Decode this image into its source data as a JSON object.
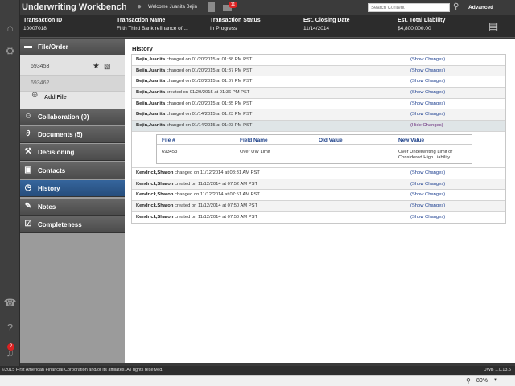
{
  "header": {
    "app_title": "Underwriting Workbench",
    "welcome": "Welcome Juanita Bejin",
    "mail_badge": "11",
    "search_placeholder": "Search Content",
    "advanced_label": "Advanced"
  },
  "transaction": {
    "id_label": "Transaction ID",
    "id_value": "10007018",
    "name_label": "Transaction Name",
    "name_value": "Fifth Third Bank refinance of ...",
    "status_label": "Transaction Status",
    "status_value": "In Progress",
    "closing_label": "Est. Closing Date",
    "closing_value": "11/14/2014",
    "liability_label": "Est. Total Liability",
    "liability_value": "$4,800,000.00"
  },
  "sidebar": {
    "file_order": "File/Order",
    "files": [
      "693453",
      "693462"
    ],
    "add_file": "Add File",
    "items": [
      {
        "label": "Collaboration (0)"
      },
      {
        "label": "Documents (5)"
      },
      {
        "label": "Decisioning"
      },
      {
        "label": "Contacts"
      },
      {
        "label": "History"
      },
      {
        "label": "Notes"
      },
      {
        "label": "Completeness"
      }
    ]
  },
  "rail": {
    "notification_badge": "2"
  },
  "history": {
    "title": "History",
    "rows_top": [
      {
        "user": "Bejin,Juanita",
        "text": " changed on 01/20/2015 at 01:38 PM PST",
        "link": "(Show Changes)"
      },
      {
        "user": "Bejin,Juanita",
        "text": " changed on 01/20/2015 at 01:37 PM PST",
        "link": "(Show Changes)"
      },
      {
        "user": "Bejin,Juanita",
        "text": " changed on 01/20/2015 at 01:37 PM PST",
        "link": "(Show Changes)"
      },
      {
        "user": "Bejin,Juanita",
        "text": " created on 01/20/2015 at 01:36 PM PST",
        "link": "(Show Changes)"
      },
      {
        "user": "Bejin,Juanita",
        "text": " changed on 01/20/2015 at 01:35 PM PST",
        "link": "(Show Changes)"
      },
      {
        "user": "Bejin,Juanita",
        "text": " changed on 01/14/2015 at 01:23 PM PST",
        "link": "(Show Changes)"
      },
      {
        "user": "Bejin,Juanita",
        "text": " changed on 01/14/2015 at 01:23 PM PST",
        "link": "(Hide Changes)"
      }
    ],
    "detail": {
      "headers": [
        "File #",
        "Field Name",
        "Old Value",
        "New Value"
      ],
      "file_no": "693453",
      "field_name": "Over UW Limit",
      "old_value": "",
      "new_value_line1": "Over Underwriting Limit or",
      "new_value_line2": "Considered High Liability"
    },
    "rows_bottom": [
      {
        "user": "Kendrick,Sharon",
        "text": " changed on 11/12/2014 at 08:31 AM PST",
        "link": "(Show Changes)"
      },
      {
        "user": "Kendrick,Sharon",
        "text": " created on 11/12/2014 at 07:52 AM PST",
        "link": "(Show Changes)"
      },
      {
        "user": "Kendrick,Sharon",
        "text": " changed on 11/12/2014 at 07:51 AM PST",
        "link": "(Show Changes)"
      },
      {
        "user": "Kendrick,Sharon",
        "text": " created on 11/12/2014 at 07:50 AM PST",
        "link": "(Show Changes)"
      },
      {
        "user": "Kendrick,Sharon",
        "text": " created on 11/12/2014 at 07:50 AM PST",
        "link": "(Show Changes)"
      }
    ]
  },
  "footer": {
    "copyright": "©2015 First American Financial Corporation and/or its affiliates. All rights reserved.",
    "version": "UWB 1.0.13.5"
  },
  "status": {
    "zoom": "80%"
  }
}
